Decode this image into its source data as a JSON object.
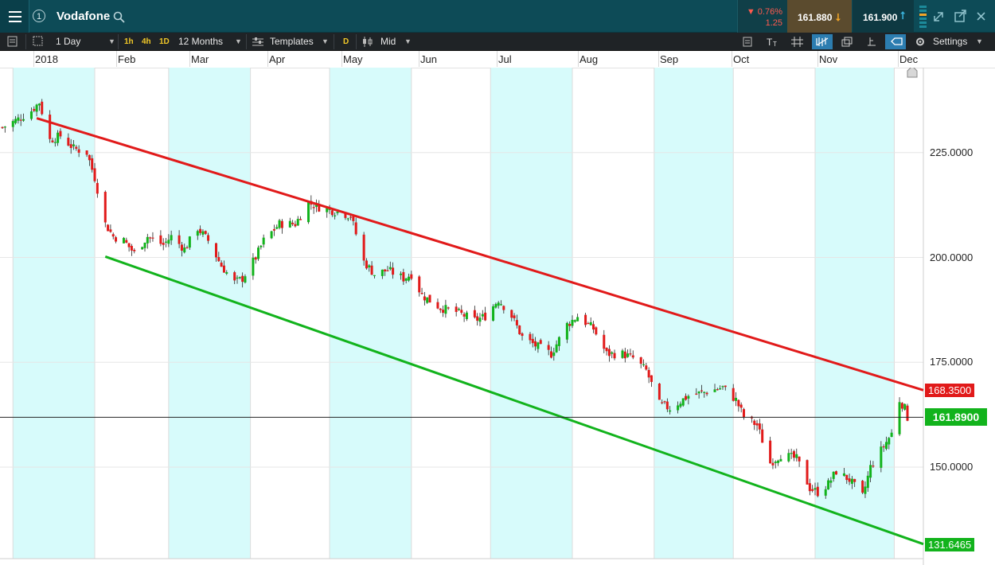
{
  "header": {
    "symbol": "Vodafone",
    "change_percent": "0.76%",
    "change_value": "1.25",
    "bid": "161.880",
    "ask": "161.900"
  },
  "toolbar": {
    "interval": "1 Day",
    "quick_intervals": [
      "1h",
      "4h",
      "1D"
    ],
    "range": "12 Months",
    "templates": "Templates",
    "d_badge": "D",
    "price_type": "Mid",
    "settings": "Settings"
  },
  "colors": {
    "header_bg": "#0d4b57",
    "toolbar_bg": "#1f2326",
    "up_candle": "#12b31c",
    "down_candle": "#e11a1a",
    "month_band": "#d7fbfb",
    "upper_channel": "#e11a1a",
    "lower_channel": "#12b31c"
  },
  "chart_data": {
    "type": "candlestick",
    "months": [
      "2018",
      "Feb",
      "Mar",
      "Apr",
      "May",
      "Jun",
      "Jul",
      "Aug",
      "Sep",
      "Oct",
      "Nov",
      "Dec"
    ],
    "y_ticks": [
      "225.0000",
      "200.0000",
      "175.0000",
      "150.0000"
    ],
    "y_tick_values": [
      225,
      200,
      175,
      150
    ],
    "ylim": [
      124,
      239
    ],
    "x_range": [
      "2017-12-28",
      "2018-12-06"
    ],
    "current_price": "161.8900",
    "current_value": 161.89,
    "channel_upper_label": "168.3500",
    "channel_lower_label": "131.6465",
    "trendlines": [
      {
        "name": "upper",
        "color": "#e11a1a",
        "from": [
          "2018-01-10",
          233.2
        ],
        "to": [
          "2018-12-05",
          168.35
        ]
      },
      {
        "name": "lower",
        "color": "#12b31c",
        "from": [
          "2018-02-05",
          200.2
        ],
        "to": [
          "2018-12-05",
          131.6465
        ]
      }
    ],
    "close_path": [
      [
        "2017-12-28",
        231
      ],
      [
        "2018-01-03",
        233
      ],
      [
        "2018-01-08",
        235
      ],
      [
        "2018-01-11",
        237
      ],
      [
        "2018-01-15",
        228
      ],
      [
        "2018-01-19",
        229
      ],
      [
        "2018-01-24",
        226
      ],
      [
        "2018-01-29",
        225
      ],
      [
        "2018-02-01",
        219
      ],
      [
        "2018-02-05",
        208
      ],
      [
        "2018-02-08",
        205
      ],
      [
        "2018-02-12",
        204
      ],
      [
        "2018-02-16",
        201
      ],
      [
        "2018-02-21",
        205
      ],
      [
        "2018-02-27",
        203
      ],
      [
        "2018-03-02",
        205
      ],
      [
        "2018-03-07",
        202
      ],
      [
        "2018-03-12",
        207
      ],
      [
        "2018-03-16",
        204
      ],
      [
        "2018-03-21",
        198
      ],
      [
        "2018-03-26",
        194
      ],
      [
        "2018-03-29",
        195
      ],
      [
        "2018-04-03",
        200
      ],
      [
        "2018-04-06",
        204
      ],
      [
        "2018-04-12",
        208
      ],
      [
        "2018-04-18",
        208
      ],
      [
        "2018-04-23",
        213
      ],
      [
        "2018-04-27",
        212
      ],
      [
        "2018-05-03",
        211
      ],
      [
        "2018-05-09",
        210
      ],
      [
        "2018-05-14",
        199
      ],
      [
        "2018-05-18",
        196
      ],
      [
        "2018-05-23",
        197
      ],
      [
        "2018-05-29",
        195
      ],
      [
        "2018-06-01",
        196
      ],
      [
        "2018-06-05",
        191
      ],
      [
        "2018-06-12",
        188
      ],
      [
        "2018-06-18",
        187
      ],
      [
        "2018-06-25",
        185
      ],
      [
        "2018-06-29",
        186
      ],
      [
        "2018-07-04",
        190
      ],
      [
        "2018-07-09",
        186
      ],
      [
        "2018-07-13",
        181
      ],
      [
        "2018-07-18",
        179
      ],
      [
        "2018-07-24",
        177
      ],
      [
        "2018-07-30",
        184
      ],
      [
        "2018-08-03",
        186
      ],
      [
        "2018-08-09",
        183
      ],
      [
        "2018-08-14",
        177
      ],
      [
        "2018-08-20",
        177
      ],
      [
        "2018-08-24",
        176
      ],
      [
        "2018-08-29",
        173
      ],
      [
        "2018-09-03",
        165
      ],
      [
        "2018-09-07",
        164
      ],
      [
        "2018-09-14",
        167
      ],
      [
        "2018-09-21",
        168
      ],
      [
        "2018-09-27",
        169
      ],
      [
        "2018-10-02",
        166
      ],
      [
        "2018-10-05",
        162
      ],
      [
        "2018-10-10",
        160
      ],
      [
        "2018-10-15",
        151
      ],
      [
        "2018-10-19",
        153
      ],
      [
        "2018-10-25",
        152
      ],
      [
        "2018-10-30",
        145
      ],
      [
        "2018-11-02",
        144
      ],
      [
        "2018-11-06",
        146
      ],
      [
        "2018-11-09",
        149
      ],
      [
        "2018-11-14",
        147
      ],
      [
        "2018-11-19",
        143
      ],
      [
        "2018-11-22",
        150
      ],
      [
        "2018-11-27",
        155
      ],
      [
        "2018-11-30",
        158
      ],
      [
        "2018-12-03",
        166
      ],
      [
        "2018-12-05",
        164
      ],
      [
        "2018-12-06",
        161.89
      ]
    ]
  }
}
